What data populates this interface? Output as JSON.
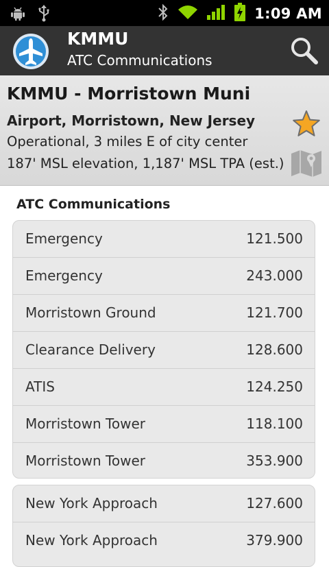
{
  "status_bar": {
    "time": "1:09 AM",
    "icons": [
      "android-debug-icon",
      "usb-icon",
      "bluetooth-icon",
      "wifi-icon",
      "signal-icon",
      "battery-charging-icon"
    ]
  },
  "action_bar": {
    "title": "KMMU",
    "subtitle": "ATC Communications",
    "app_icon": "airplane-icon",
    "search_icon": "search-icon"
  },
  "airport": {
    "name": "KMMU - Morristown Muni",
    "location": "Airport, Morristown, New Jersey",
    "status": "Operational, 3 miles E of city center",
    "elevation": "187' MSL elevation, 1,187' MSL TPA (est.)",
    "favorite_icon": "star-icon",
    "map_icon": "map-icon"
  },
  "atc": {
    "section_title": "ATC Communications",
    "groups": [
      [
        {
          "label": "Emergency",
          "freq": "121.500"
        },
        {
          "label": "Emergency",
          "freq": "243.000"
        },
        {
          "label": "Morristown Ground",
          "freq": "121.700"
        },
        {
          "label": "Clearance Delivery",
          "freq": "128.600"
        },
        {
          "label": "ATIS",
          "freq": "124.250"
        },
        {
          "label": "Morristown Tower",
          "freq": "118.100"
        },
        {
          "label": "Morristown Tower",
          "freq": "353.900"
        }
      ],
      [
        {
          "label": "New York Approach",
          "freq": "127.600"
        },
        {
          "label": "New York Approach",
          "freq": "379.900"
        }
      ]
    ]
  },
  "colors": {
    "status_bar": "#000000",
    "action_bar": "#333333",
    "header_bg": "#dedede",
    "card_bg": "#e9e9e9",
    "star": "#f5a623",
    "wifi": "#8fd400"
  }
}
